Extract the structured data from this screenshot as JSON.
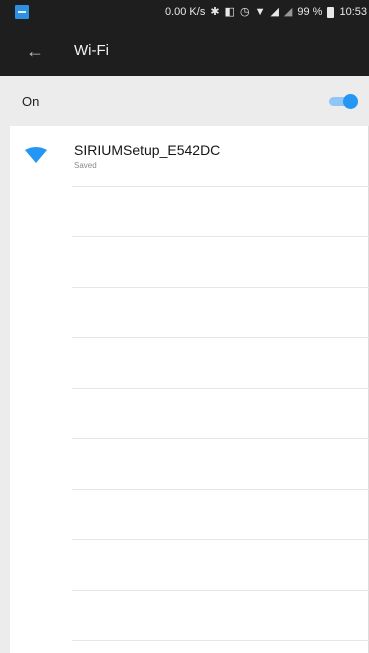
{
  "status_bar": {
    "net_speed": "0.00 K/s",
    "battery": "99 %",
    "time": "10:53"
  },
  "app_bar": {
    "title": "Wi-Fi"
  },
  "master_switch": {
    "label": "On",
    "state": true
  },
  "networks": [
    {
      "name": "SIRIUMSetup_E542DC",
      "status": "Saved"
    }
  ],
  "colors": {
    "accent": "#2496f3",
    "bar_background": "#1e1e1e",
    "master_row_background": "#ececec"
  }
}
